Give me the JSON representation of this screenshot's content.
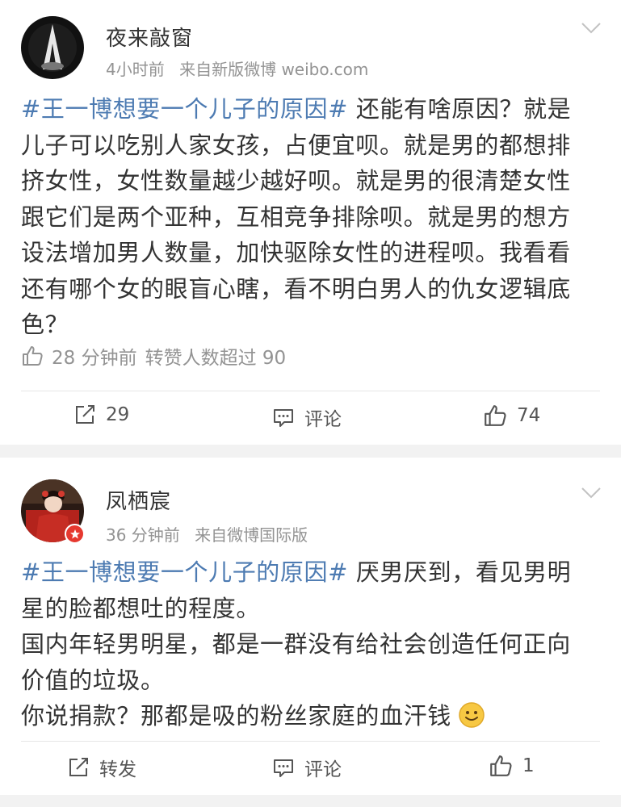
{
  "posts": [
    {
      "username": "夜来敲窗",
      "time": "4小时前",
      "source": "来自新版微博 weibo.com",
      "hashtag": "#王一博想要一个儿子的原因#",
      "lines": [
        "还能有啥原因？就是",
        "儿子可以吃别人家女孩，占便宜呗。就是男的都想排",
        "挤女性，女性数量越少越好呗。就是男的很清楚女性",
        "跟它们是两个亚种，互相竞争排除呗。就是男的想方",
        "设法增加男人数量，加快驱除女性的进程呗。我看看",
        "还有哪个女的眼盲心瞎，看不明白男人的仇女逻辑底",
        "色？"
      ],
      "like_time": "28 分钟前",
      "like_summary": "转赞人数超过 90",
      "repost": "29",
      "comment": "评论",
      "like": "74"
    },
    {
      "username": "凤栖宸",
      "time": "36 分钟前",
      "source": "来自微博国际版",
      "hashtag": "#王一博想要一个儿子的原因#",
      "lines": [
        "厌男厌到，看见男明",
        "星的脸都想吐的程度。",
        "国内年轻男明星，都是一群没有给社会创造任何正向",
        "价值的垃圾。",
        "你说捐款？那都是吸的粉丝家庭的血汗钱"
      ],
      "emoji": "smile-emoji",
      "repost": "转发",
      "comment": "评论",
      "like": "1"
    }
  ],
  "colors": {
    "hashtag": "#4d7bb2",
    "meta": "#939393",
    "text": "#333333",
    "badge": "#e6382f"
  },
  "icons": [
    "chevron-down-icon",
    "thumb-up-icon",
    "repost-icon",
    "comment-icon",
    "verified-badge-icon"
  ]
}
